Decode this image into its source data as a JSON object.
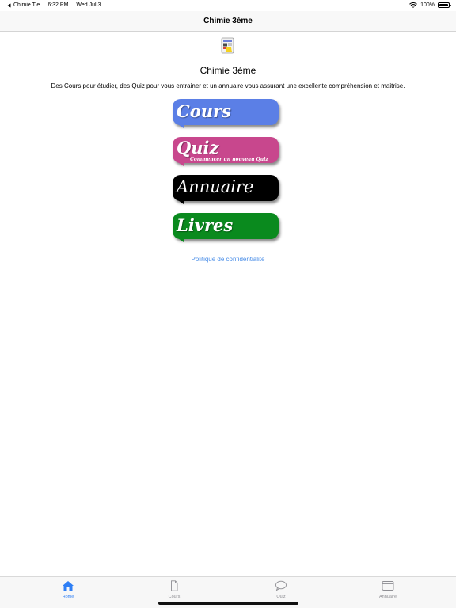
{
  "status_bar": {
    "back_app": "Chimie Tle",
    "time": "6:32 PM",
    "date": "Wed Jul 3",
    "battery": "100%",
    "battery_level": 1.0
  },
  "nav": {
    "title": "Chimie 3ème"
  },
  "content": {
    "heading": "Chimie 3ème",
    "intro": "Des Cours pour étudier, des Quiz pour vous entrainer et un annuaire vous assurant une excellente compréhension et maitrise.",
    "buttons": [
      {
        "label": "Cours",
        "sublabel": "",
        "color": "#5b7fe6"
      },
      {
        "label": "Quiz",
        "sublabel": "Commencer un nouveau Quiz",
        "color": "#c8478d"
      },
      {
        "label": "Annuaire",
        "sublabel": "",
        "color": "#000000"
      },
      {
        "label": "Livres",
        "sublabel": "",
        "color": "#0a8a1e"
      }
    ],
    "privacy_link": "Politique de confidentialite"
  },
  "tabs": [
    {
      "label": "Home",
      "icon": "house-icon",
      "active": true
    },
    {
      "label": "Cours",
      "icon": "document-icon",
      "active": false
    },
    {
      "label": "Quiz",
      "icon": "speech-bubble-icon",
      "active": false
    },
    {
      "label": "Annuaire",
      "icon": "folder-icon",
      "active": false
    }
  ],
  "colors": {
    "accent": "#2f7ff5",
    "link": "#4a8ee8",
    "tab_inactive": "#8e8e93"
  }
}
